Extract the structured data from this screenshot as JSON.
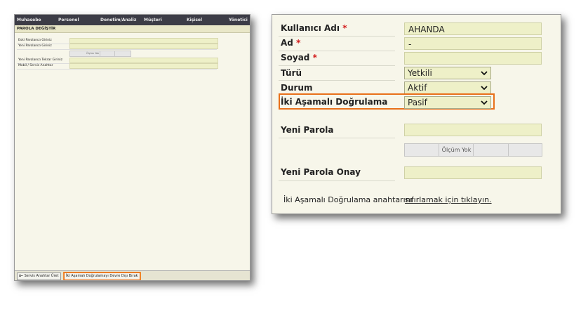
{
  "left_panel": {
    "nav": [
      "Muhasebe",
      "Personel",
      "Denetim/Analiz",
      "Müşteri",
      "Kişisel",
      "Yönetici"
    ],
    "title": "PAROLA DEĞİŞTİR",
    "fields": {
      "old_password_label": "Eski Parolanızı Giriniz",
      "new_password_label": "Yeni Parolanızı Giriniz",
      "strength_label": "Ölçüm Yok",
      "confirm_password_label": "Yeni Parolanızı Tekrar Giriniz",
      "mobile_key_label": "Mobil / Servis Anahtar"
    },
    "footer": {
      "generate_key_button": "Servis Anahtar Üret",
      "disable_2fa_button": "İki Aşamalı Doğrulamayı Devre Dışı Bırak"
    }
  },
  "right_panel": {
    "username": {
      "label": "Kullanıcı Adı",
      "required_mark": "*",
      "value": "AHANDA"
    },
    "first_name": {
      "label": "Ad",
      "required_mark": "*",
      "value": "-"
    },
    "last_name": {
      "label": "Soyad",
      "required_mark": "*",
      "value": ""
    },
    "type": {
      "label": "Türü",
      "selected": "Yetkili"
    },
    "status": {
      "label": "Durum",
      "selected": "Aktif"
    },
    "two_factor": {
      "label": "İki Aşamalı Doğrulama",
      "selected": "Pasif"
    },
    "new_password": {
      "label": "Yeni Parola",
      "value": ""
    },
    "strength": {
      "label": "Ölçüm Yok"
    },
    "confirm_password": {
      "label": "Yeni Parola Onay",
      "value": ""
    },
    "reset_2fa": {
      "prefix": "İki Aşamalı Doğrulama anahtarını",
      "link": "sıfırlamak için tıklayın."
    }
  },
  "colors": {
    "highlight": "#e8701a",
    "input_bg": "#eef0c8",
    "panel_bg": "#f7f6ea",
    "required": "#d21a1a",
    "nav_bg": "#3c3c46"
  },
  "icons": {
    "select_chevron": "chevron-down-icon",
    "key": "key-icon"
  }
}
